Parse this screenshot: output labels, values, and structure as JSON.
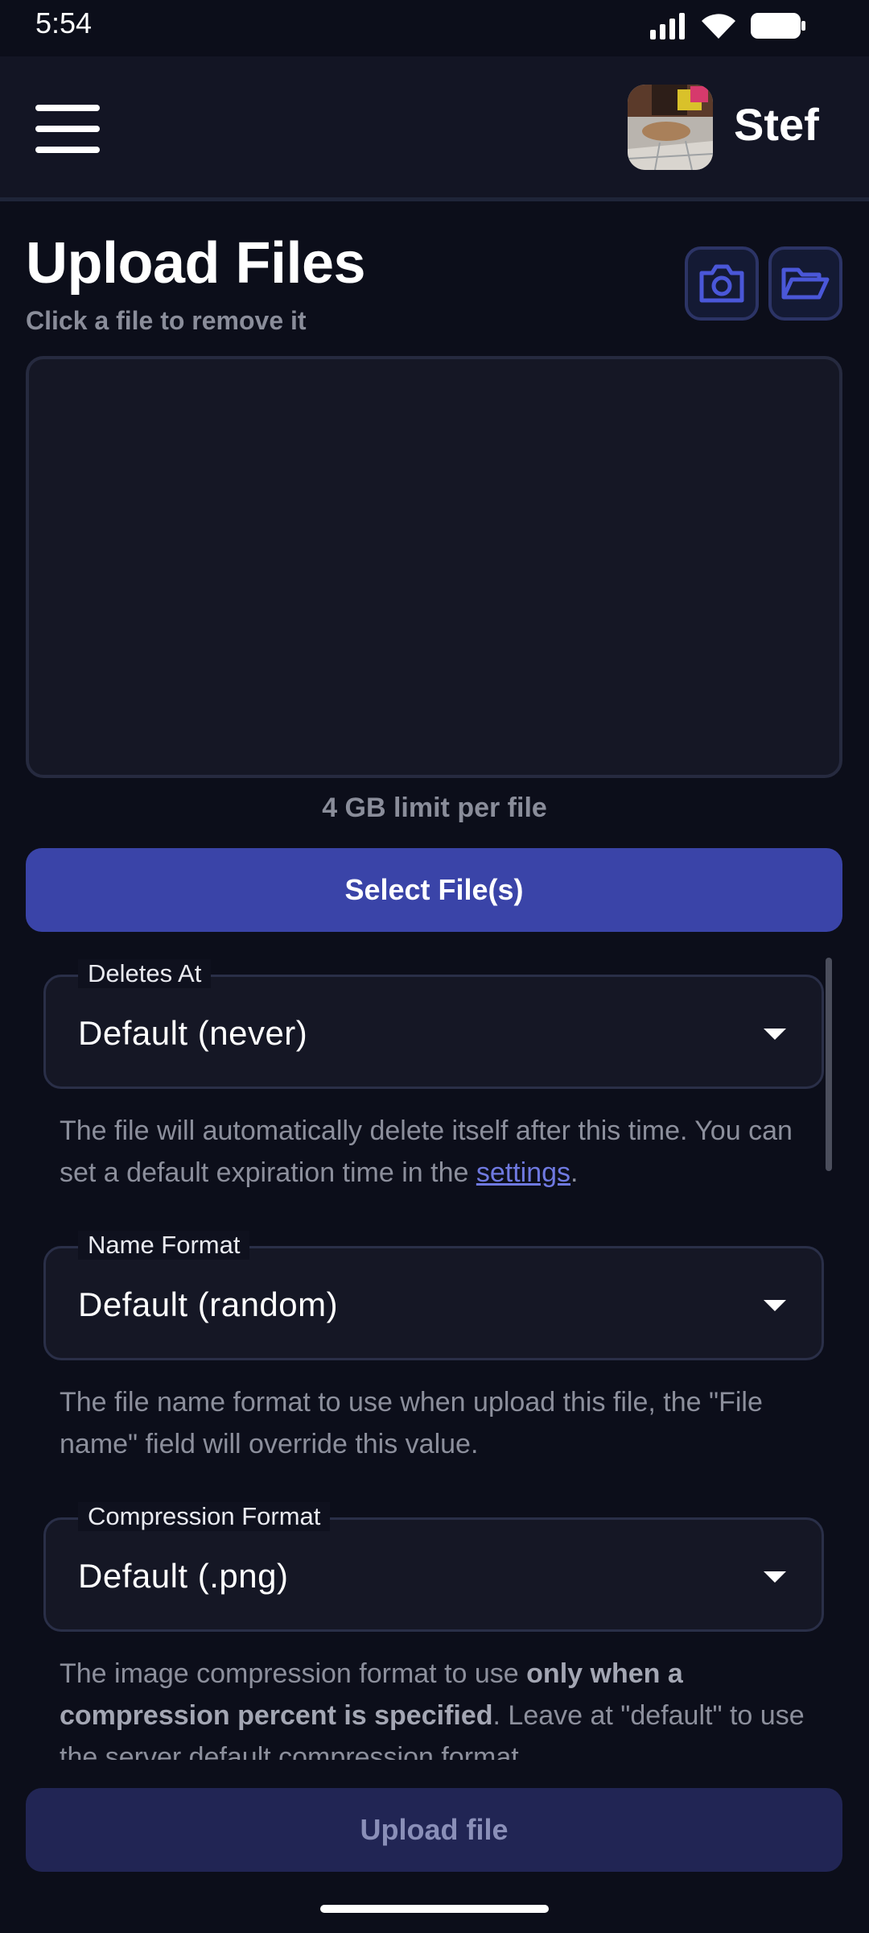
{
  "status_bar": {
    "time": "5:54",
    "icons": [
      "signal-icon",
      "wifi-icon",
      "battery-icon"
    ]
  },
  "header": {
    "menu_icon": "hamburger-menu-icon",
    "user_name": "Stef"
  },
  "upload": {
    "title": "Upload Files",
    "subtitle": "Click a file to remove it",
    "camera_icon": "camera-icon",
    "folder_icon": "folder-open-icon",
    "limit_text": "4 GB limit per file",
    "select_label": "Select File(s)"
  },
  "options": {
    "deletes_at": {
      "legend": "Deletes At",
      "value": "Default (never)",
      "help_text": "The file will automatically delete itself after this time. You can set a default expiration time in the ",
      "help_link": "settings",
      "help_end": "."
    },
    "name_format": {
      "legend": "Name Format",
      "value": "Default (random)",
      "help_text": "The file name format to use when upload this file, the \"File name\" field will override this value."
    },
    "compression_format": {
      "legend": "Compression Format",
      "value": "Default (.png)",
      "help_pre": "The image compression format to use ",
      "help_bold": "only when a compression percent is specified",
      "help_post": ". Leave at \"default\" to use the server default compression format."
    }
  },
  "footer": {
    "upload_label": "Upload file"
  },
  "colors": {
    "background": "#0c0e1a",
    "header": "#131524",
    "accent": "#3a44a8",
    "upload_disabled": "#212554",
    "link": "#6f79e0"
  }
}
